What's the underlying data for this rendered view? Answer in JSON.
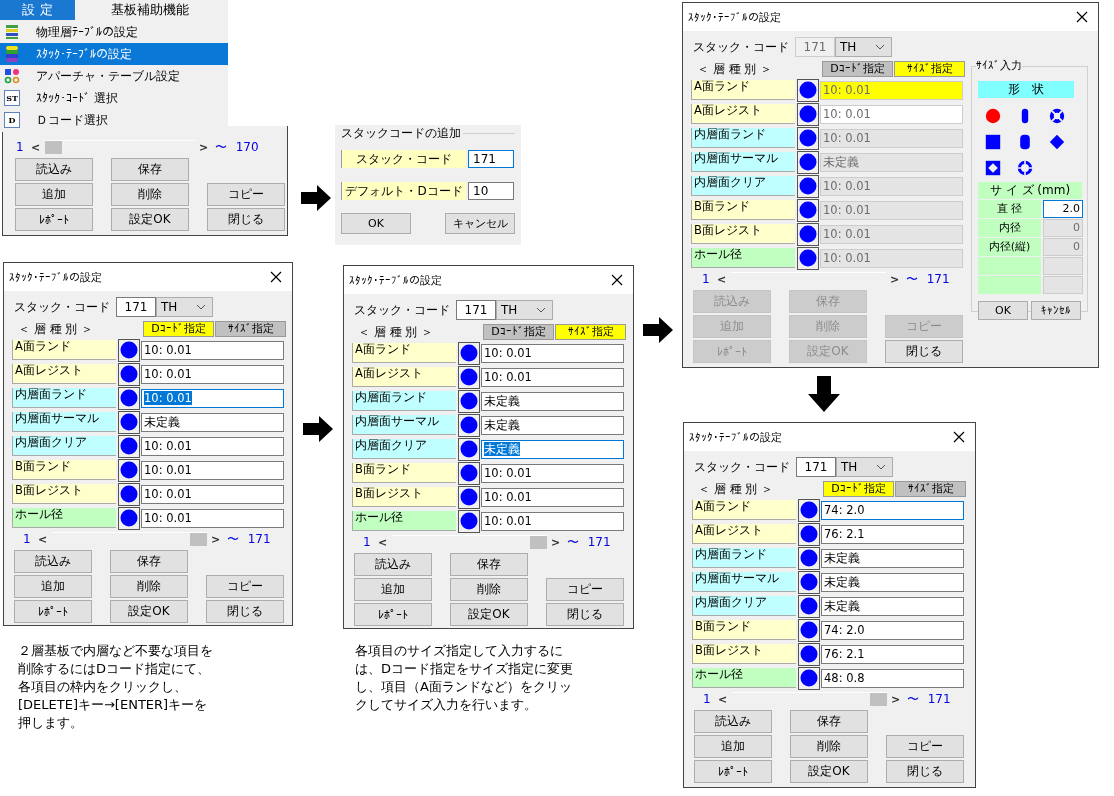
{
  "menu": {
    "tabs": [
      {
        "label": "設 定",
        "selected": true
      },
      {
        "label": "基板補助機能",
        "selected": false
      }
    ],
    "items": [
      {
        "label": "物理層ﾃｰﾌﾞﾙの設定",
        "kind": "layers",
        "selected": false
      },
      {
        "label": "ｽﾀｯｸ･ﾃｰﾌﾞﾙの設定",
        "kind": "stack",
        "selected": true
      },
      {
        "label": "アパーチャ・テーブル設定",
        "kind": "shapes",
        "selected": false
      },
      {
        "label": "ｽﾀｯｸ･ｺｰﾄﾞ 選択",
        "kind": "letters",
        "icon_text": "ST",
        "selected": false
      },
      {
        "label": "Ｄコード選択",
        "kind": "letters",
        "icon_text": "D",
        "selected": false
      }
    ]
  },
  "background_window": {
    "pager": {
      "start": "1",
      "prev": "<",
      "next": ">",
      "tilde": "〜",
      "end": "170"
    },
    "buttons": [
      {
        "label": "読込み",
        "disabled": false
      },
      {
        "label": "保存",
        "disabled": false
      },
      {
        "label": "追加",
        "disabled": false
      },
      {
        "label": "削除",
        "disabled": false
      },
      {
        "label": "コピー",
        "disabled": false
      },
      {
        "label": "ﾚﾎﾟｰﾄ",
        "disabled": false
      },
      {
        "label": "設定OK",
        "disabled": false
      },
      {
        "label": "閉じる",
        "disabled": false
      }
    ]
  },
  "add_dialog": {
    "title": "スタックコードの追加",
    "fields": [
      {
        "label": "スタック・コード",
        "value": "171",
        "focused": true
      },
      {
        "label": "デフォルト・Dコード",
        "value": "10",
        "focused": false
      }
    ],
    "buttons": [
      {
        "label": "OK"
      },
      {
        "label": "キャンセル"
      }
    ]
  },
  "dialogs": [
    {
      "title": "ｽﾀｯｸ･ﾃｰﾌﾞﾙの設定",
      "code_label": "スタック・コード",
      "code_value": "171",
      "code_disabled": false,
      "values_greyed": false,
      "layer_type": "TH",
      "layer_heading": "＜ 層 種 別 ＞",
      "tabs": [
        {
          "label": "Dｺｰﾄﾞ指定",
          "selected": true
        },
        {
          "label": "ｻｲｽﾞ指定",
          "selected": false
        }
      ],
      "rows": [
        {
          "label": "A面ランド",
          "color": "#ffffcc",
          "value": "10: 0.01",
          "selected": false,
          "focused": false
        },
        {
          "label": "A面レジスト",
          "color": "#ffffcc",
          "value": "10: 0.01",
          "selected": false,
          "focused": false
        },
        {
          "label": "内層面ランド",
          "color": "#c0ffff",
          "value": "10: 0.01",
          "selected": true,
          "focused": true
        },
        {
          "label": "内層面サーマル",
          "color": "#c0ffff",
          "value": "未定義",
          "selected": false,
          "focused": false
        },
        {
          "label": "内層面クリア",
          "color": "#c0ffff",
          "value": "10: 0.01",
          "selected": false,
          "focused": false
        },
        {
          "label": "B面ランド",
          "color": "#ffffcc",
          "value": "10: 0.01",
          "selected": false,
          "focused": false
        },
        {
          "label": "B面レジスト",
          "color": "#ffffcc",
          "value": "10: 0.01",
          "selected": false,
          "focused": false
        },
        {
          "label": "ホール径",
          "color": "#c0ffc0",
          "value": "10: 0.01",
          "selected": false,
          "focused": false
        }
      ],
      "pager": {
        "start": "1",
        "prev": "<",
        "next": ">",
        "tilde": "〜",
        "end": "171"
      },
      "buttons": [
        {
          "label": "読込み",
          "disabled": false
        },
        {
          "label": "保存",
          "disabled": false
        },
        {
          "label": "追加",
          "disabled": false
        },
        {
          "label": "削除",
          "disabled": false
        },
        {
          "label": "コピー",
          "disabled": false
        },
        {
          "label": "ﾚﾎﾟｰﾄ",
          "disabled": false
        },
        {
          "label": "設定OK",
          "disabled": false
        },
        {
          "label": "閉じる",
          "disabled": false
        }
      ]
    },
    {
      "title": "ｽﾀｯｸ･ﾃｰﾌﾞﾙの設定",
      "code_label": "スタック・コード",
      "code_value": "171",
      "code_disabled": false,
      "values_greyed": false,
      "layer_type": "TH",
      "layer_heading": "＜ 層 種 別 ＞",
      "tabs": [
        {
          "label": "Dｺｰﾄﾞ指定",
          "selected": false
        },
        {
          "label": "ｻｲｽﾞ指定",
          "selected": true
        }
      ],
      "rows": [
        {
          "label": "A面ランド",
          "color": "#ffffcc",
          "value": "10: 0.01",
          "selected": false,
          "focused": false
        },
        {
          "label": "A面レジスト",
          "color": "#ffffcc",
          "value": "10: 0.01",
          "selected": false,
          "focused": false
        },
        {
          "label": "内層面ランド",
          "color": "#c0ffff",
          "value": "未定義",
          "selected": false,
          "focused": false
        },
        {
          "label": "内層面サーマル",
          "color": "#c0ffff",
          "value": "未定義",
          "selected": false,
          "focused": false
        },
        {
          "label": "内層面クリア",
          "color": "#c0ffff",
          "value": "未定義",
          "selected": true,
          "focused": true
        },
        {
          "label": "B面ランド",
          "color": "#ffffcc",
          "value": "10: 0.01",
          "selected": false,
          "focused": false
        },
        {
          "label": "B面レジスト",
          "color": "#ffffcc",
          "value": "10: 0.01",
          "selected": false,
          "focused": false
        },
        {
          "label": "ホール径",
          "color": "#c0ffc0",
          "value": "10: 0.01",
          "selected": false,
          "focused": false
        }
      ],
      "pager": {
        "start": "1",
        "prev": "<",
        "next": ">",
        "tilde": "〜",
        "end": "171"
      },
      "buttons": [
        {
          "label": "読込み",
          "disabled": false
        },
        {
          "label": "保存",
          "disabled": false
        },
        {
          "label": "追加",
          "disabled": false
        },
        {
          "label": "削除",
          "disabled": false
        },
        {
          "label": "コピー",
          "disabled": false
        },
        {
          "label": "ﾚﾎﾟｰﾄ",
          "disabled": false
        },
        {
          "label": "設定OK",
          "disabled": false
        },
        {
          "label": "閉じる",
          "disabled": false
        }
      ]
    },
    {
      "title": "ｽﾀｯｸ･ﾃｰﾌﾞﾙの設定",
      "code_label": "スタック・コード",
      "code_value": "171",
      "code_disabled": true,
      "values_greyed": true,
      "layer_type": "TH",
      "layer_heading": "＜ 層 種 別 ＞",
      "tabs": [
        {
          "label": "Dｺｰﾄﾞ指定",
          "selected": false
        },
        {
          "label": "ｻｲｽﾞ指定",
          "selected": true
        }
      ],
      "rows": [
        {
          "label": "A面ランド",
          "color": "#ffffcc",
          "value": "10: 0.01",
          "highlighted": true,
          "disabled": false
        },
        {
          "label": "A面レジスト",
          "color": "#ffffcc",
          "value": "10: 0.01",
          "highlighted": false,
          "disabled": false
        },
        {
          "label": "内層面ランド",
          "color": "#c0ffff",
          "value": "10: 0.01",
          "highlighted": false,
          "disabled": true
        },
        {
          "label": "内層面サーマル",
          "color": "#c0ffff",
          "value": "未定義",
          "highlighted": false,
          "disabled": true
        },
        {
          "label": "内層面クリア",
          "color": "#c0ffff",
          "value": "10: 0.01",
          "highlighted": false,
          "disabled": true
        },
        {
          "label": "B面ランド",
          "color": "#ffffcc",
          "value": "10: 0.01",
          "highlighted": false,
          "disabled": true
        },
        {
          "label": "B面レジスト",
          "color": "#ffffcc",
          "value": "10: 0.01",
          "highlighted": false,
          "disabled": true
        },
        {
          "label": "ホール径",
          "color": "#c0ffc0",
          "value": "10: 0.01",
          "highlighted": false,
          "disabled": true
        }
      ],
      "pager": {
        "start": "1",
        "prev": "<",
        "next": ">",
        "tilde": "〜",
        "end": "171"
      },
      "buttons": [
        {
          "label": "読込み",
          "disabled": true
        },
        {
          "label": "保存",
          "disabled": true
        },
        {
          "label": "追加",
          "disabled": true
        },
        {
          "label": "削除",
          "disabled": true
        },
        {
          "label": "コピー",
          "disabled": true
        },
        {
          "label": "ﾚﾎﾟｰﾄ",
          "disabled": true
        },
        {
          "label": "設定OK",
          "disabled": true
        },
        {
          "label": "閉じる",
          "disabled": false
        }
      ],
      "size_panel": {
        "title": "ｻｲｽﾞ入力",
        "shape_heading": "形　状",
        "shapes": [
          {
            "kind": "circle",
            "selected": true
          },
          {
            "kind": "oblong",
            "selected": false
          },
          {
            "kind": "thermal",
            "selected": false
          },
          {
            "kind": "square",
            "selected": false
          },
          {
            "kind": "rounded",
            "selected": false
          },
          {
            "kind": "diamond",
            "selected": false
          },
          {
            "kind": "notched",
            "selected": false
          },
          {
            "kind": "ring",
            "selected": false
          }
        ],
        "size_heading": "サ イ ズ (mm)",
        "fields": [
          {
            "label": "直 径",
            "value": "2.0",
            "focused": true,
            "disabled": false
          },
          {
            "label": "内径",
            "value": "0",
            "focused": false,
            "disabled": true
          },
          {
            "label": "内径(縦)",
            "value": "0",
            "focused": false,
            "disabled": true
          },
          {
            "focused": false,
            "disabled": true
          },
          {
            "focused": false,
            "disabled": true
          }
        ],
        "buttons": [
          {
            "label": "OK"
          },
          {
            "label": "ｷｬﾝｾﾙ"
          }
        ]
      }
    },
    {
      "title": "ｽﾀｯｸ･ﾃｰﾌﾞﾙの設定",
      "code_label": "スタック・コード",
      "code_value": "171",
      "code_disabled": false,
      "values_greyed": false,
      "layer_type": "TH",
      "layer_heading": "＜ 層 種 別 ＞",
      "tabs": [
        {
          "label": "Dｺｰﾄﾞ指定",
          "selected": true
        },
        {
          "label": "ｻｲｽﾞ指定",
          "selected": false
        }
      ],
      "rows": [
        {
          "label": "A面ランド",
          "color": "#ffffcc",
          "value": "74: 2.0",
          "selected": false,
          "focused": true
        },
        {
          "label": "A面レジスト",
          "color": "#ffffcc",
          "value": "76: 2.1",
          "selected": false,
          "focused": false
        },
        {
          "label": "内層面ランド",
          "color": "#c0ffff",
          "value": "未定義",
          "selected": false,
          "focused": false
        },
        {
          "label": "内層面サーマル",
          "color": "#c0ffff",
          "value": "未定義",
          "selected": false,
          "focused": false
        },
        {
          "label": "内層面クリア",
          "color": "#c0ffff",
          "value": "未定義",
          "selected": false,
          "focused": false
        },
        {
          "label": "B面ランド",
          "color": "#ffffcc",
          "value": "74: 2.0",
          "selected": false,
          "focused": false
        },
        {
          "label": "B面レジスト",
          "color": "#ffffcc",
          "value": "76: 2.1",
          "selected": false,
          "focused": false
        },
        {
          "label": "ホール径",
          "color": "#c0ffc0",
          "value": "48: 0.8",
          "selected": false,
          "focused": false
        }
      ],
      "pager": {
        "start": "1",
        "prev": "<",
        "next": ">",
        "tilde": "〜",
        "end": "171"
      },
      "buttons": [
        {
          "label": "読込み",
          "disabled": false
        },
        {
          "label": "保存",
          "disabled": false
        },
        {
          "label": "追加",
          "disabled": false
        },
        {
          "label": "削除",
          "disabled": false
        },
        {
          "label": "コピー",
          "disabled": false
        },
        {
          "label": "ﾚﾎﾟｰﾄ",
          "disabled": false
        },
        {
          "label": "設定OK",
          "disabled": false
        },
        {
          "label": "閉じる",
          "disabled": false
        }
      ]
    }
  ],
  "notes": [
    {
      "lines": [
        "２層基板で内層など不要な項目を",
        "削除するにはDコード指定にて、",
        "各項目の枠内をクリックし、",
        "[DELETE]キー→[ENTER]キーを",
        "押します。"
      ]
    },
    {
      "lines": [
        "各項目のサイズ指定して入力するに",
        "は、Dコード指定をサイズ指定に変更",
        "し、項目（A面ランドなど）をクリッ",
        "クしてサイズ入力を行います。"
      ]
    }
  ]
}
